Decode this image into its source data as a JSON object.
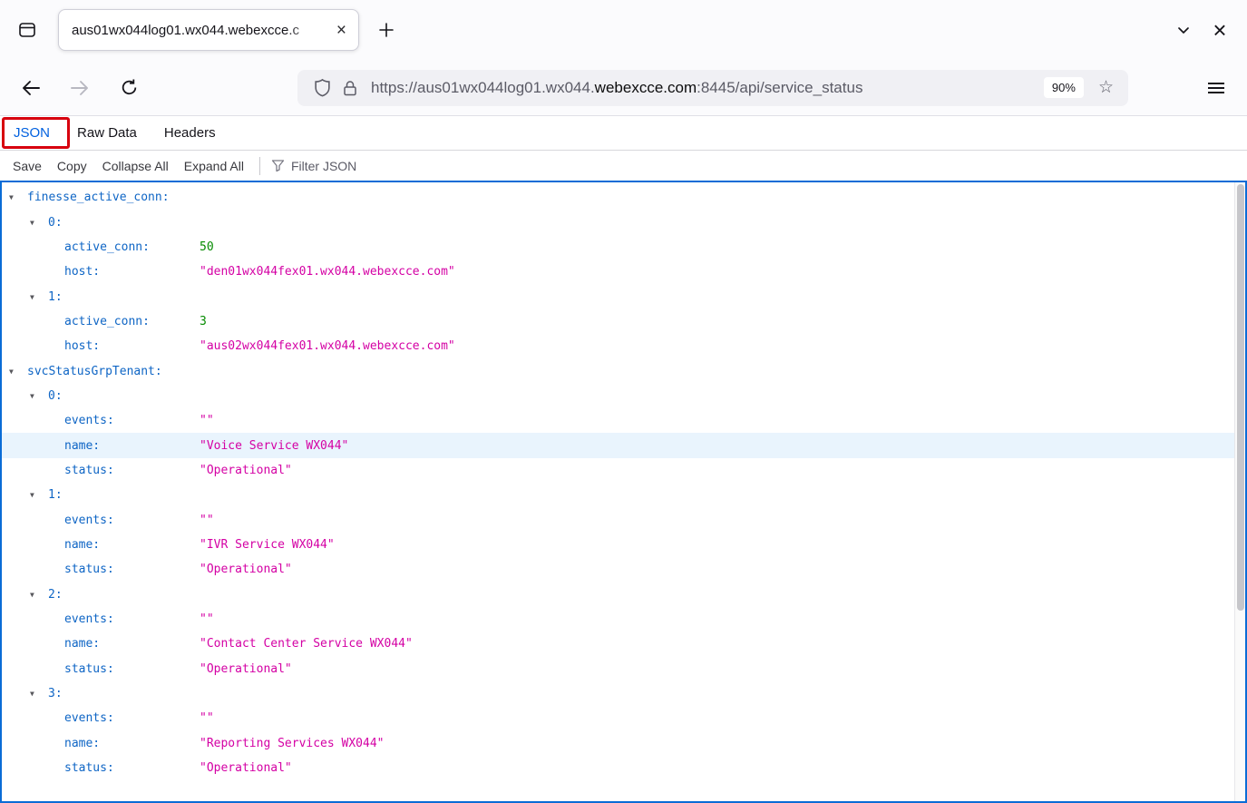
{
  "colors": {
    "key_blue": "#0e65c5",
    "string_magenta": "#d400a4",
    "number_green": "#058b00",
    "active_tab_blue": "#0060df",
    "content_border_blue": "#0a6cd6",
    "annotation_red": "#d7000e",
    "row_highlight": "#e9f4fd"
  },
  "browser": {
    "tab_title": "aus01wx044log01.wx044.webexcce.c",
    "zoom_level": "90%",
    "url_prefix": "https://aus01wx044log01.wx044.",
    "url_domain": "webexcce.com",
    "url_suffix": ":8445/api/service_status"
  },
  "viewer_tabs": {
    "json": "JSON",
    "raw_data": "Raw Data",
    "headers": "Headers"
  },
  "toolbar": {
    "save": "Save",
    "copy": "Copy",
    "collapse_all": "Collapse All",
    "expand_all": "Expand All",
    "filter_placeholder": "Filter JSON"
  },
  "json_tree": {
    "rows": [
      {
        "indent": 0,
        "arrow": true,
        "key": "finesse_active_conn:"
      },
      {
        "indent": 1,
        "arrow": true,
        "key": "0:"
      },
      {
        "indent": 2,
        "key": "active_conn:",
        "value": "50",
        "type": "number"
      },
      {
        "indent": 2,
        "key": "host:",
        "value": "\"den01wx044fex01.wx044.webexcce.com\"",
        "type": "string"
      },
      {
        "indent": 1,
        "arrow": true,
        "key": "1:"
      },
      {
        "indent": 2,
        "key": "active_conn:",
        "value": "3",
        "type": "number"
      },
      {
        "indent": 2,
        "key": "host:",
        "value": "\"aus02wx044fex01.wx044.webexcce.com\"",
        "type": "string"
      },
      {
        "indent": 0,
        "arrow": true,
        "key": "svcStatusGrpTenant:"
      },
      {
        "indent": 1,
        "arrow": true,
        "key": "0:"
      },
      {
        "indent": 2,
        "key": "events:",
        "value": "\"\"",
        "type": "string"
      },
      {
        "indent": 2,
        "key": "name:",
        "value": "\"Voice Service WX044\"",
        "type": "string",
        "highlighted": true
      },
      {
        "indent": 2,
        "key": "status:",
        "value": "\"Operational\"",
        "type": "string"
      },
      {
        "indent": 1,
        "arrow": true,
        "key": "1:"
      },
      {
        "indent": 2,
        "key": "events:",
        "value": "\"\"",
        "type": "string"
      },
      {
        "indent": 2,
        "key": "name:",
        "value": "\"IVR Service WX044\"",
        "type": "string"
      },
      {
        "indent": 2,
        "key": "status:",
        "value": "\"Operational\"",
        "type": "string"
      },
      {
        "indent": 1,
        "arrow": true,
        "key": "2:"
      },
      {
        "indent": 2,
        "key": "events:",
        "value": "\"\"",
        "type": "string"
      },
      {
        "indent": 2,
        "key": "name:",
        "value": "\"Contact Center Service WX044\"",
        "type": "string"
      },
      {
        "indent": 2,
        "key": "status:",
        "value": "\"Operational\"",
        "type": "string"
      },
      {
        "indent": 1,
        "arrow": true,
        "key": "3:"
      },
      {
        "indent": 2,
        "key": "events:",
        "value": "\"\"",
        "type": "string"
      },
      {
        "indent": 2,
        "key": "name:",
        "value": "\"Reporting Services WX044\"",
        "type": "string"
      },
      {
        "indent": 2,
        "key": "status:",
        "value": "\"Operational\"",
        "type": "string"
      }
    ]
  }
}
